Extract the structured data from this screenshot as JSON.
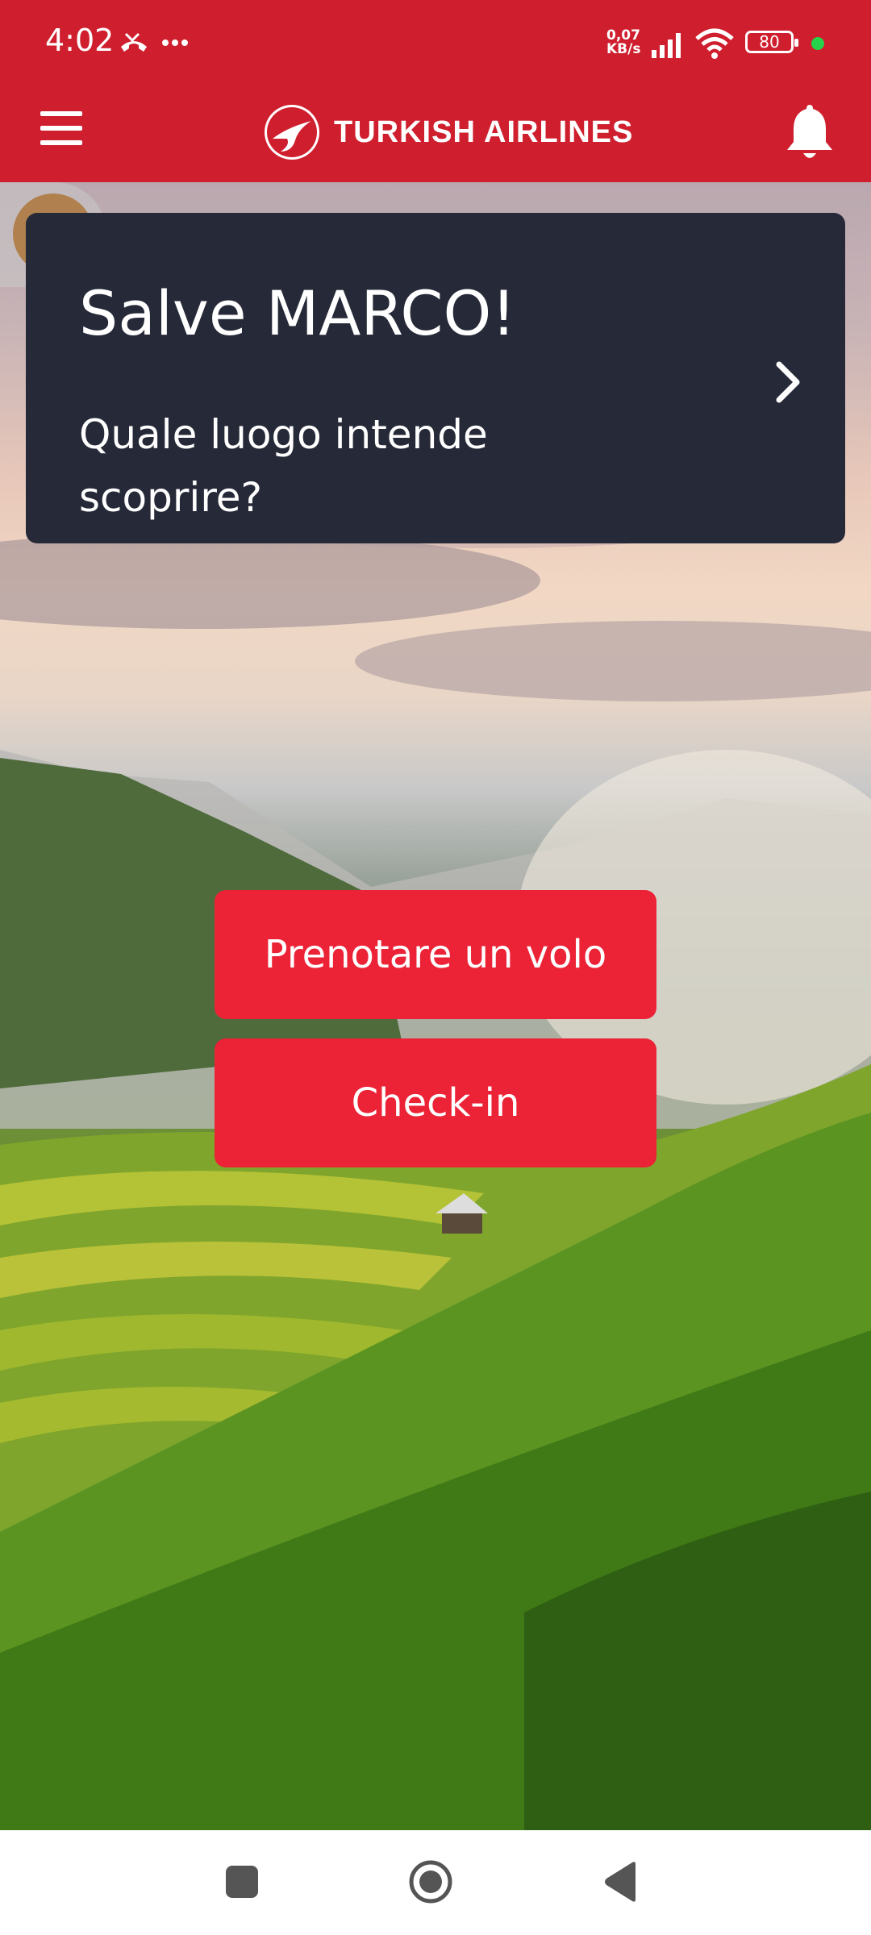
{
  "status_bar": {
    "time": "4:02",
    "net_speed_value": "0,07",
    "net_speed_unit": "KB/s",
    "battery": "80"
  },
  "header": {
    "brand": "TURKISH AIRLINES"
  },
  "greeting": {
    "title": "Salve MARCO!",
    "subtitle": "Quale luogo intende scoprire?"
  },
  "actions": {
    "book_flight": "Prenotare un volo",
    "checkin": "Check-in"
  },
  "icons": {
    "menu": "hamburger-menu-icon",
    "notifications": "bell-icon",
    "accessibility": "accessibility-icon",
    "chevron": "chevron-right-icon"
  },
  "colors": {
    "brand_red": "#cf1f2e",
    "button_red": "#ec2236",
    "card_bg": "#262a38"
  }
}
